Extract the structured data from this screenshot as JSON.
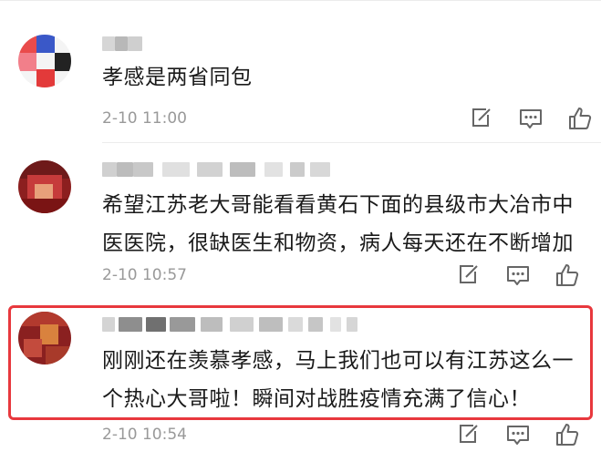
{
  "comments": [
    {
      "text": "孝感是两省同包",
      "time": "2-10 11:00"
    },
    {
      "text": "希望江苏老大哥能看看黄石下面的县级市大冶市中\n医医院，很缺医生和物资，病人每天还在不断增加",
      "time": "2-10 10:57"
    },
    {
      "text": "刚刚还在羡慕孝感，马上我们也可以有江苏这么一\n个热心大哥啦！瞬间对战胜疫情充满了信心！",
      "time": "2-10 10:54"
    }
  ],
  "icons": {
    "reply": "reply-icon",
    "comment": "comment-icon",
    "like": "like-icon"
  },
  "colors": {
    "highlight": "#e8383d",
    "meta_text": "#999999",
    "body_text": "#1a1a1a"
  }
}
